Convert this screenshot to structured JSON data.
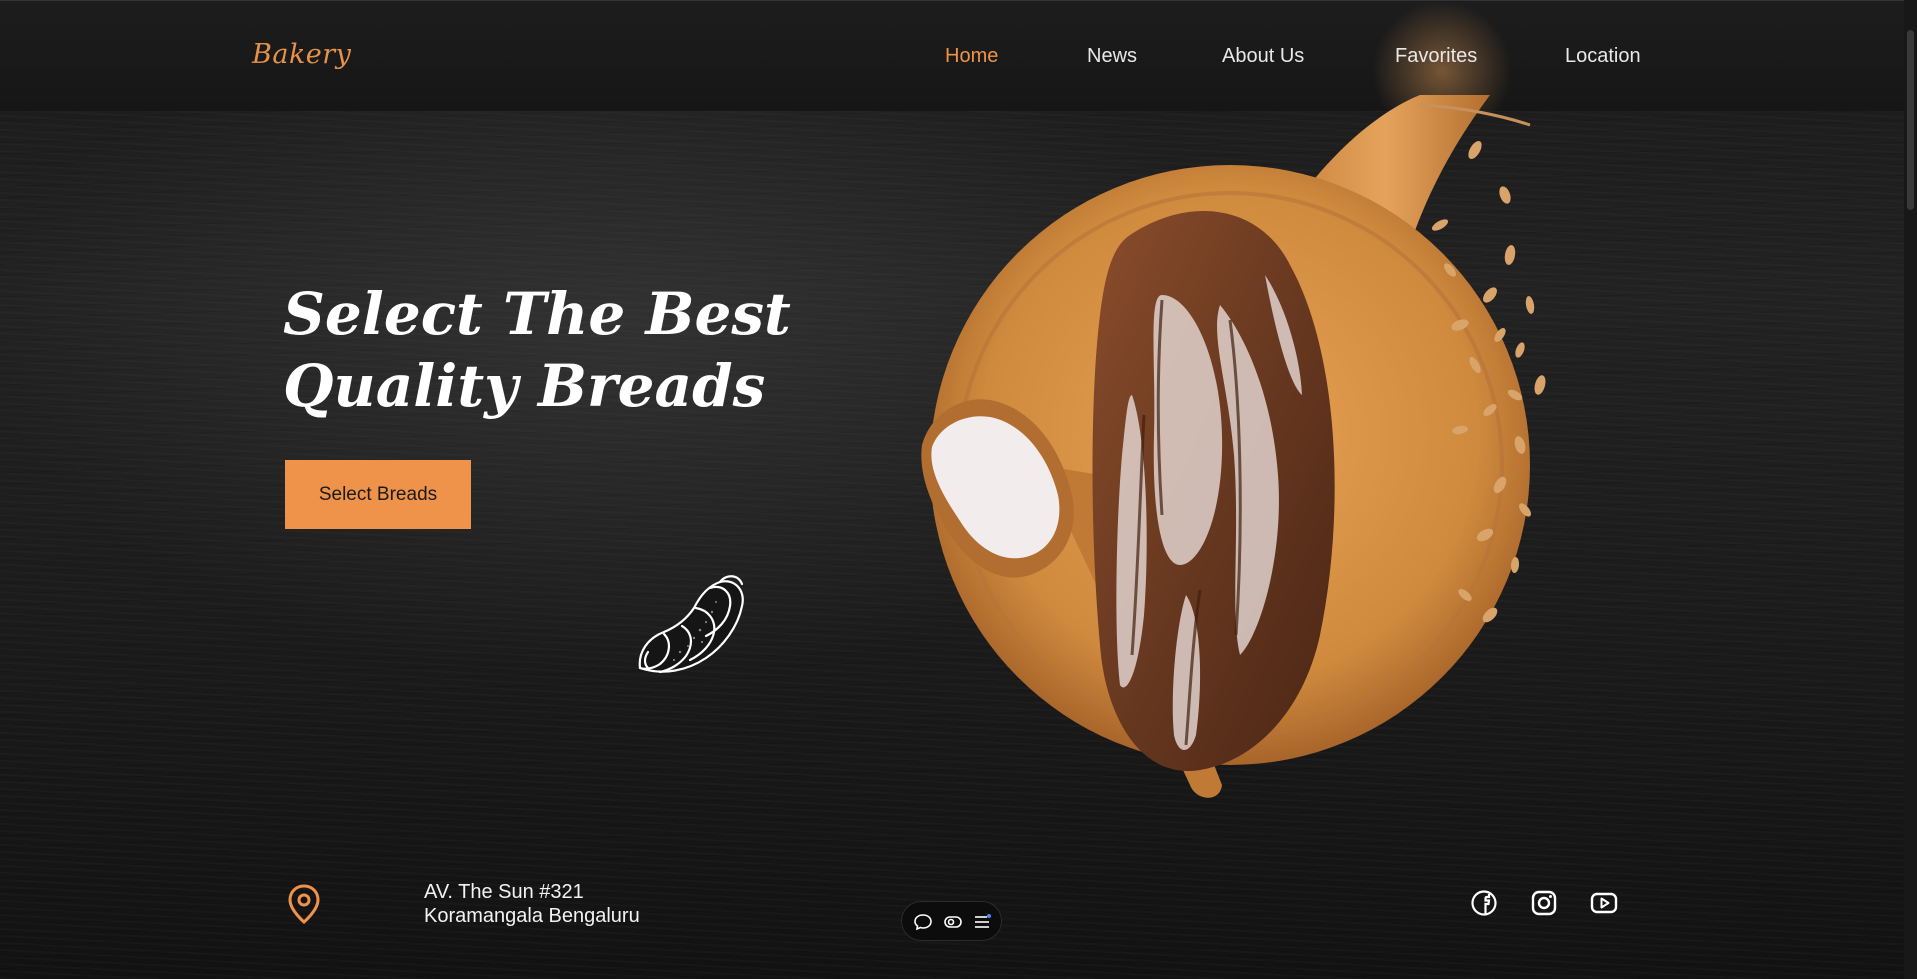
{
  "header": {
    "logo": "Bakery",
    "nav": [
      {
        "label": "Home",
        "active": true
      },
      {
        "label": "News",
        "active": false
      },
      {
        "label": "About Us",
        "active": false
      },
      {
        "label": "Favorites",
        "active": false
      },
      {
        "label": "Location",
        "active": false
      }
    ]
  },
  "hero": {
    "title_line1": "Select The Best",
    "title_line2": "Quality Breads",
    "cta_label": "Select Breads"
  },
  "footer": {
    "address_line1": "AV. The Sun #321",
    "address_line2": "Koramangala Bengaluru",
    "social": [
      "facebook-icon",
      "instagram-icon",
      "youtube-icon"
    ],
    "toolbar_icons": [
      "chat-bubble-icon",
      "toggle-icon",
      "menu-lines-icon"
    ]
  },
  "colors": {
    "accent": "#f0934a",
    "background": "#1a1a1a",
    "text": "#ffffff"
  }
}
